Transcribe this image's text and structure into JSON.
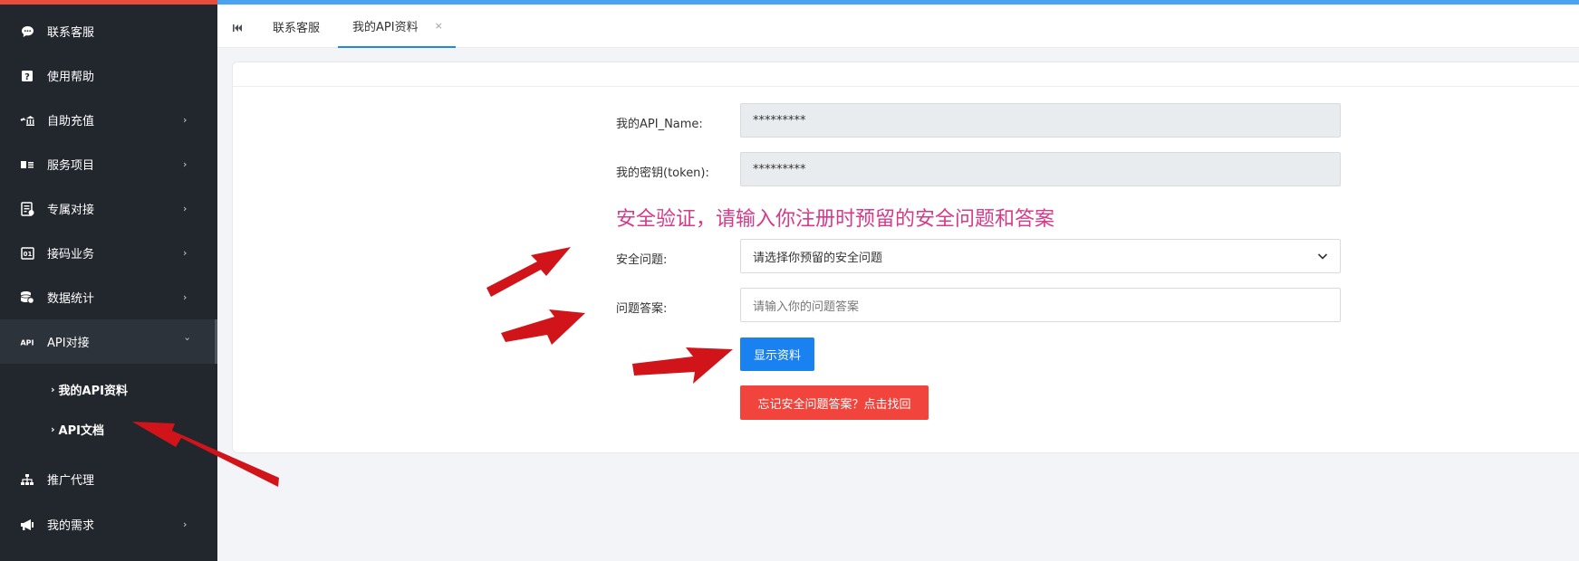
{
  "sidebar": {
    "items": [
      {
        "label": "联系客服",
        "icon": "chat-bubble-icon",
        "has_arrow": false
      },
      {
        "label": "使用帮助",
        "icon": "question-box-icon",
        "has_arrow": false
      },
      {
        "label": "自助充值",
        "icon": "bank-transfer-icon",
        "has_arrow": true
      },
      {
        "label": "服务项目",
        "icon": "id-card-icon",
        "has_arrow": true
      },
      {
        "label": "专属对接",
        "icon": "document-sync-icon",
        "has_arrow": true
      },
      {
        "label": "接码业务",
        "icon": "code-box-icon",
        "has_arrow": true
      },
      {
        "label": "数据统计",
        "icon": "database-icon",
        "has_arrow": true
      },
      {
        "label": "API对接",
        "icon": "api-text-icon",
        "has_arrow": true,
        "expanded": true
      },
      {
        "label": "推广代理",
        "icon": "sitemap-icon",
        "has_arrow": false
      },
      {
        "label": "我的需求",
        "icon": "megaphone-icon",
        "has_arrow": true
      }
    ],
    "submenu": [
      {
        "label": "我的API资料"
      },
      {
        "label": "API文档"
      }
    ]
  },
  "tabs": {
    "home_icon": "skip-back-icon",
    "items": [
      {
        "label": "联系客服",
        "active": false
      },
      {
        "label": "我的API资料",
        "active": true,
        "close": "×"
      }
    ]
  },
  "form": {
    "api_name_label": "我的API_Name:",
    "api_name_value": "*********",
    "token_label": "我的密钥(token):",
    "token_value": "*********",
    "security_heading": "安全验证，请输入你注册时预留的安全问题和答案",
    "question_label": "安全问题:",
    "question_select_value": "请选择你预留的安全问题",
    "answer_label": "问题答案:",
    "answer_placeholder": "请输入你的问题答案",
    "show_button": "显示资料",
    "forgot_button": "忘记安全问题答案？点击找回"
  },
  "colors": {
    "sidebar_bg": "#22272e",
    "top_left_accent": "#e74c3c",
    "top_right_accent": "#4aa3f0",
    "heading_pink": "#d63a88",
    "primary_blue": "#1a82f0",
    "danger_red": "#f0443c",
    "annotation_arrow": "#d0141a"
  }
}
